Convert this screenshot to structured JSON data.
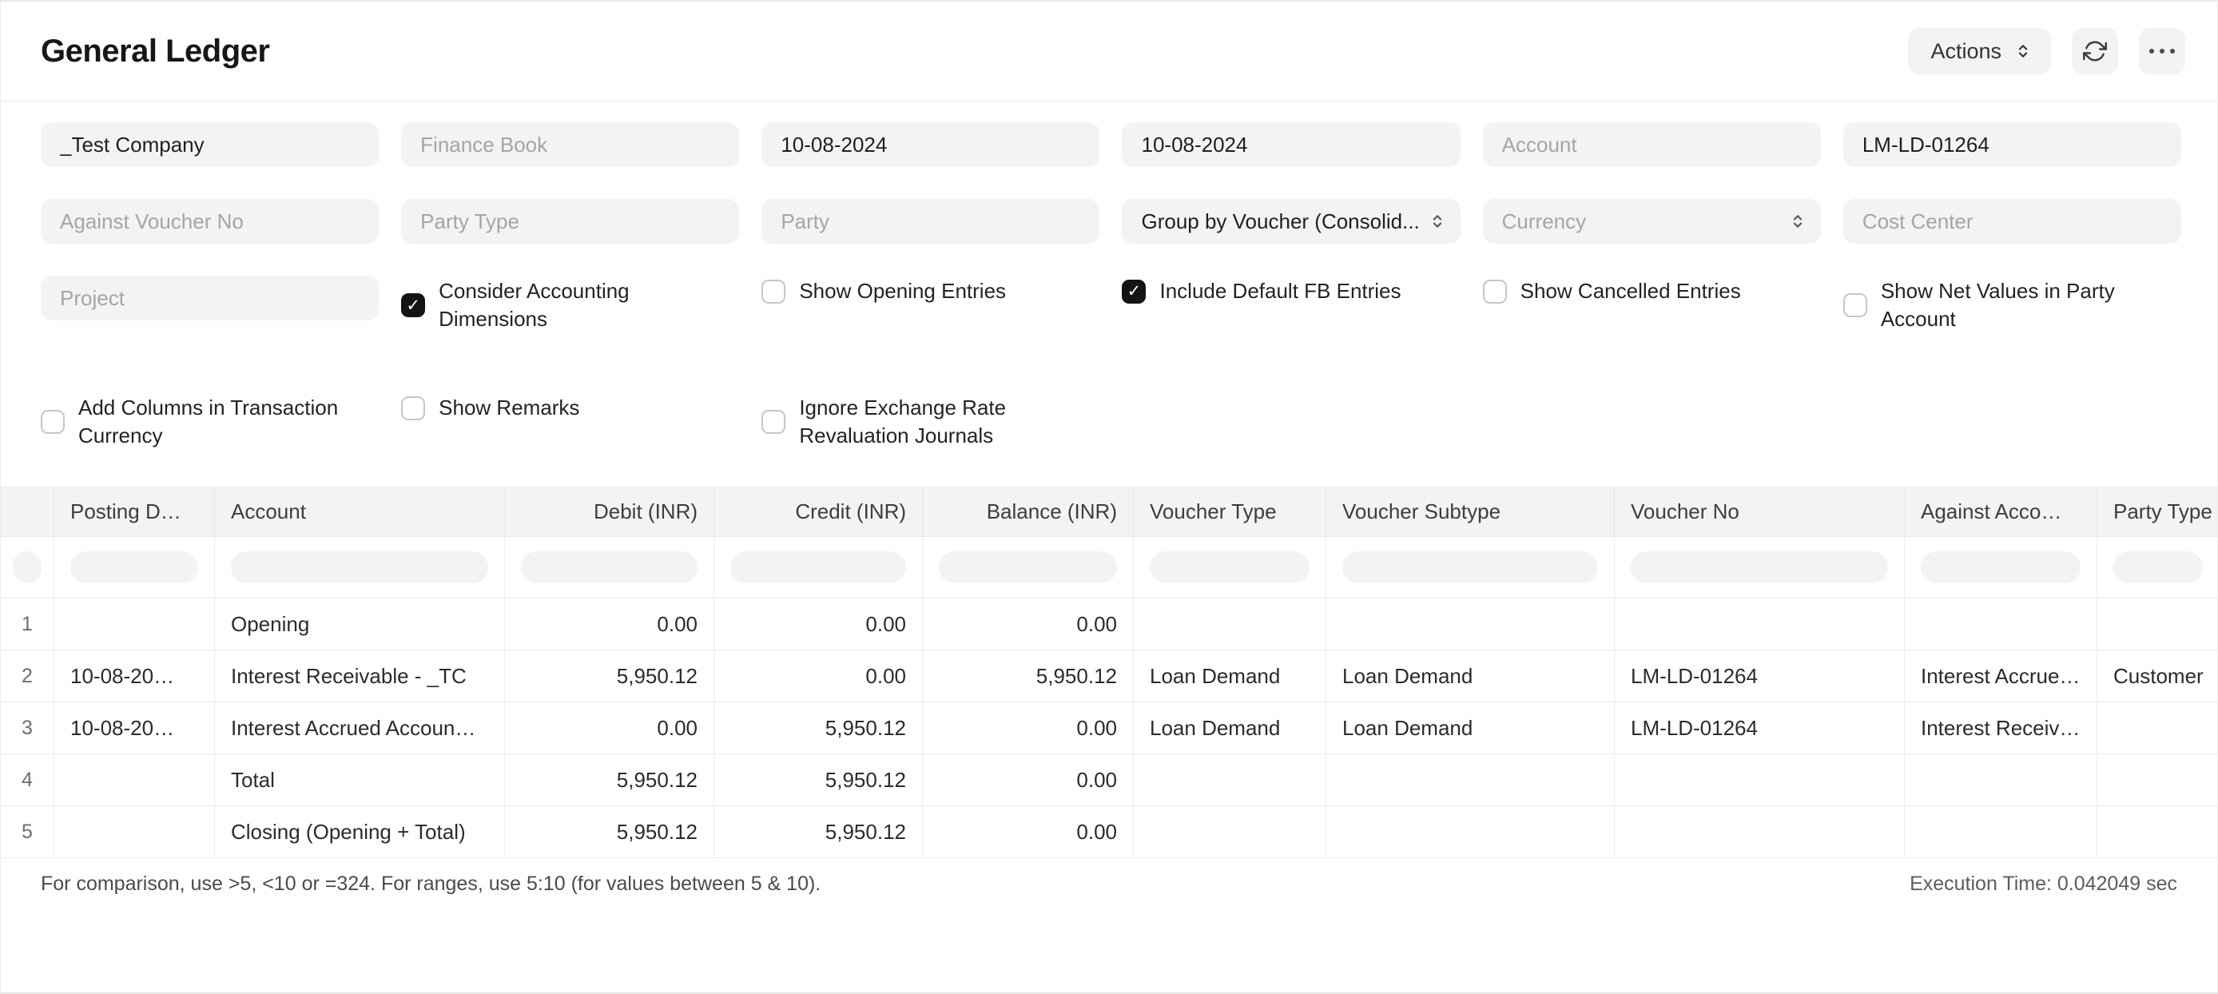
{
  "header": {
    "title": "General Ledger",
    "actions_label": "Actions"
  },
  "filters": {
    "company": "_Test Company",
    "finance_book_placeholder": "Finance Book",
    "from_date": "10-08-2024",
    "to_date": "10-08-2024",
    "account_placeholder": "Account",
    "voucher_no": "LM-LD-01264",
    "against_voucher_placeholder": "Against Voucher No",
    "party_type_placeholder": "Party Type",
    "party_placeholder": "Party",
    "group_by": "Group by Voucher (Consolid...",
    "currency_placeholder": "Currency",
    "cost_center_placeholder": "Cost Center",
    "project_placeholder": "Project"
  },
  "checkboxes": {
    "consider_accounting_dimensions": {
      "label": "Consider Accounting Dimensions",
      "checked": true
    },
    "show_opening_entries": {
      "label": "Show Opening Entries",
      "checked": false
    },
    "include_default_fb_entries": {
      "label": "Include Default FB Entries",
      "checked": true
    },
    "show_cancelled_entries": {
      "label": "Show Cancelled Entries",
      "checked": false
    },
    "show_net_values_in_party_account": {
      "label": "Show Net Values in Party Account",
      "checked": false
    },
    "add_columns_in_transaction_currency": {
      "label": "Add Columns in Transaction Currency",
      "checked": false
    },
    "show_remarks": {
      "label": "Show Remarks",
      "checked": false
    },
    "ignore_exchange_rate_revaluation_journals": {
      "label": "Ignore Exchange Rate Revaluation Journals",
      "checked": false
    }
  },
  "table": {
    "columns": [
      "Posting D…",
      "Account",
      "Debit (INR)",
      "Credit (INR)",
      "Balance (INR)",
      "Voucher Type",
      "Voucher Subtype",
      "Voucher No",
      "Against Acco…",
      "Party Type"
    ],
    "rows": [
      {
        "idx": "1",
        "posting_date": "",
        "account": "Opening",
        "debit": "0.00",
        "credit": "0.00",
        "balance": "0.00",
        "voucher_type": "",
        "voucher_subtype": "",
        "voucher_no": "",
        "against_account": "",
        "party_type": ""
      },
      {
        "idx": "2",
        "posting_date": "10-08-20…",
        "account": "Interest Receivable - _TC",
        "debit": "5,950.12",
        "credit": "0.00",
        "balance": "5,950.12",
        "voucher_type": "Loan Demand",
        "voucher_subtype": "Loan Demand",
        "voucher_no": "LM-LD-01264",
        "against_account": "Interest Accrue…",
        "party_type": "Customer"
      },
      {
        "idx": "3",
        "posting_date": "10-08-20…",
        "account": "Interest Accrued Accoun…",
        "debit": "0.00",
        "credit": "5,950.12",
        "balance": "0.00",
        "voucher_type": "Loan Demand",
        "voucher_subtype": "Loan Demand",
        "voucher_no": "LM-LD-01264",
        "against_account": "Interest Receiv…",
        "party_type": ""
      },
      {
        "idx": "4",
        "posting_date": "",
        "account": "Total",
        "debit": "5,950.12",
        "credit": "5,950.12",
        "balance": "0.00",
        "voucher_type": "",
        "voucher_subtype": "",
        "voucher_no": "",
        "against_account": "",
        "party_type": ""
      },
      {
        "idx": "5",
        "posting_date": "",
        "account": "Closing (Opening + Total)",
        "debit": "5,950.12",
        "credit": "5,950.12",
        "balance": "0.00",
        "voucher_type": "",
        "voucher_subtype": "",
        "voucher_no": "",
        "against_account": "",
        "party_type": ""
      }
    ]
  },
  "footer": {
    "note": "For comparison, use >5, <10 or =324. For ranges, use 5:10 (for values between 5 & 10).",
    "execution_time": "Execution Time: 0.042049 sec"
  }
}
